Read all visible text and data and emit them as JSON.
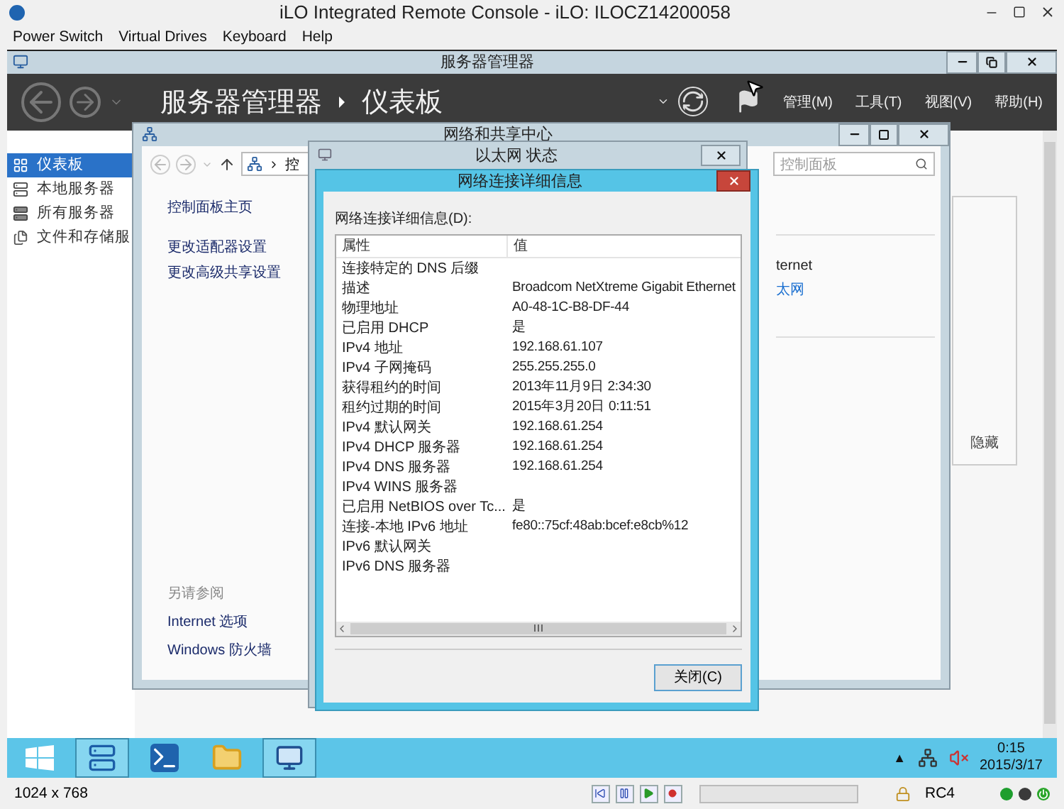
{
  "window": {
    "title": "iLO Integrated Remote Console - iLO: ILOCZ14200058"
  },
  "menu": [
    "Power Switch",
    "Virtual Drives",
    "Keyboard",
    "Help"
  ],
  "server_manager": {
    "title": "服务器管理器",
    "breadcrumb": [
      "服务器管理器",
      "仪表板"
    ],
    "menus": [
      "管理(M)",
      "工具(T)",
      "视图(V)",
      "帮助(H)"
    ],
    "sidebar": [
      {
        "label": "仪表板",
        "kind": "dashboard",
        "selected": true
      },
      {
        "label": "本地服务器",
        "kind": "server",
        "selected": false
      },
      {
        "label": "所有服务器",
        "kind": "servers",
        "selected": false
      },
      {
        "label": "文件和存储服",
        "kind": "files",
        "selected": false
      }
    ],
    "tile_action": "隐藏"
  },
  "network_center": {
    "title": "网络和共享中心",
    "address": "控",
    "search_placeholder": "控制面板",
    "links": [
      "控制面板主页",
      "更改适配器设置",
      "更改高级共享设置"
    ],
    "see_also_title": "另请参阅",
    "see_also": [
      "Internet 选项",
      "Windows 防火墙"
    ],
    "content": [
      {
        "text": "ternet",
        "kind": "text"
      },
      {
        "text": "太网",
        "kind": "link"
      }
    ]
  },
  "ethernet_status": {
    "title": "以太网 状态"
  },
  "details": {
    "title": "网络连接详细信息",
    "label": "网络连接详细信息(D):",
    "columns": [
      "属性",
      "值"
    ],
    "rows": [
      {
        "property": "连接特定的 DNS 后缀",
        "value": ""
      },
      {
        "property": "描述",
        "value": "Broadcom NetXtreme Gigabit Ethernet"
      },
      {
        "property": "物理地址",
        "value": "A0-48-1C-B8-DF-44"
      },
      {
        "property": "已启用 DHCP",
        "value": "是"
      },
      {
        "property": "IPv4 地址",
        "value": "192.168.61.107"
      },
      {
        "property": "IPv4 子网掩码",
        "value": "255.255.255.0"
      },
      {
        "property": "获得租约的时间",
        "value": "2013年11月9日 2:34:30"
      },
      {
        "property": "租约过期的时间",
        "value": "2015年3月20日 0:11:51"
      },
      {
        "property": "IPv4 默认网关",
        "value": "192.168.61.254"
      },
      {
        "property": "IPv4 DHCP 服务器",
        "value": "192.168.61.254"
      },
      {
        "property": "IPv4 DNS 服务器",
        "value": "192.168.61.254"
      },
      {
        "property": "IPv4 WINS 服务器",
        "value": ""
      },
      {
        "property": "已启用 NetBIOS over Tc...",
        "value": "是"
      },
      {
        "property": "连接-本地 IPv6 地址",
        "value": "fe80::75cf:48ab:bcef:e8cb%12"
      },
      {
        "property": "IPv6 默认网关",
        "value": ""
      },
      {
        "property": "IPv6 DNS 服务器",
        "value": ""
      }
    ],
    "close_button": "关闭(C)"
  },
  "taskbar": {
    "apps": [
      {
        "kind": "start",
        "selected": false
      },
      {
        "kind": "server-manager",
        "selected": true
      },
      {
        "kind": "powershell",
        "selected": false
      },
      {
        "kind": "explorer",
        "selected": false
      },
      {
        "kind": "control-panel",
        "selected": true
      }
    ],
    "tray_toggle": "▲",
    "time": "0:15",
    "date": "2015/3/17"
  },
  "status_bar": {
    "resolution": "1024 x 768",
    "cipher": "RC4",
    "indicators": [
      {
        "kind": "dot",
        "color": "#1e9e2e"
      },
      {
        "kind": "dot",
        "color": "#3a3a3a"
      },
      {
        "kind": "power",
        "color": "#2aa52a"
      }
    ]
  }
}
